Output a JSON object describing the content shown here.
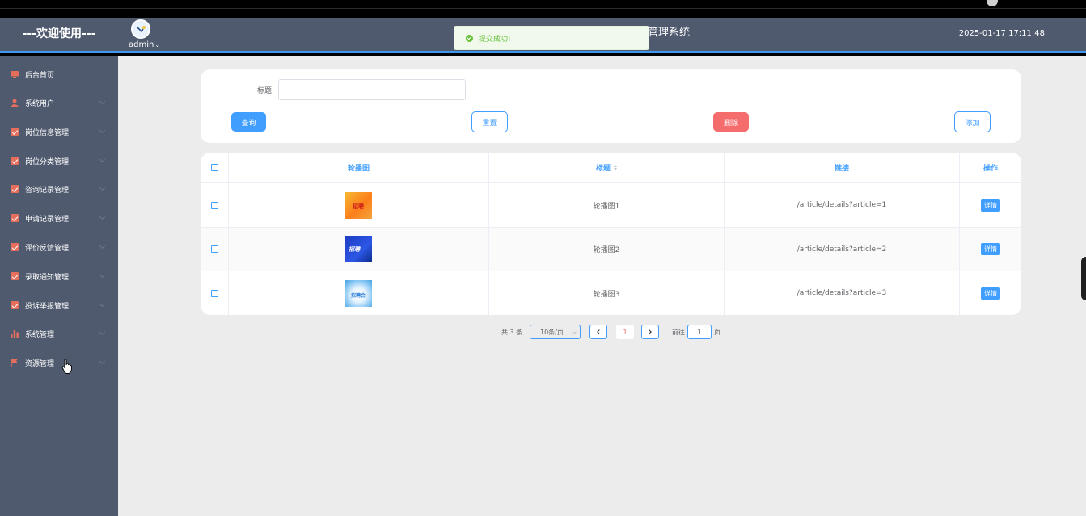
{
  "header": {
    "brand": "---欢迎使用---",
    "username": "admin",
    "title_partial": "管理系统",
    "datetime": "2025-01-17 17:11:48"
  },
  "toast": {
    "message": "提交成功!",
    "type": "success"
  },
  "sidebar": {
    "items": [
      {
        "label": "后台首页",
        "icon": "monitor-icon",
        "has_submenu": false
      },
      {
        "label": "系统用户",
        "icon": "user-icon",
        "has_submenu": true
      },
      {
        "label": "岗位信息管理",
        "icon": "checkbox-icon",
        "has_submenu": true
      },
      {
        "label": "岗位分类管理",
        "icon": "checkbox-icon",
        "has_submenu": true
      },
      {
        "label": "咨询记录管理",
        "icon": "checkbox-icon",
        "has_submenu": true
      },
      {
        "label": "申请记录管理",
        "icon": "checkbox-icon",
        "has_submenu": true
      },
      {
        "label": "评价反馈管理",
        "icon": "checkbox-icon",
        "has_submenu": true
      },
      {
        "label": "录取通知管理",
        "icon": "checkbox-icon",
        "has_submenu": true
      },
      {
        "label": "投诉举报管理",
        "icon": "checkbox-icon",
        "has_submenu": true
      },
      {
        "label": "系统管理",
        "icon": "bar-chart-icon",
        "has_submenu": true
      },
      {
        "label": "资源管理",
        "icon": "flag-icon",
        "has_submenu": true
      }
    ]
  },
  "search": {
    "title_label": "标题",
    "title_value": "",
    "query_label": "查询",
    "reset_label": "重置",
    "delete_label": "删除",
    "add_label": "添加"
  },
  "table": {
    "columns": [
      "轮播图",
      "标题",
      "链接",
      "操作"
    ],
    "rows": [
      {
        "image_text": "招聘",
        "title": "轮播图1",
        "link": "/article/details?article=1",
        "action": "详情"
      },
      {
        "image_text": "招聘",
        "title": "轮播图2",
        "link": "/article/details?article=2",
        "action": "详情"
      },
      {
        "image_text": "招聘会",
        "title": "轮播图3",
        "link": "/article/details?article=3",
        "action": "详情"
      }
    ]
  },
  "pagination": {
    "total": "共 3 条",
    "page_size": "10条/页",
    "current_page": "1",
    "goto_label": "前往",
    "goto_value": "1",
    "page_suffix": "页"
  },
  "colors": {
    "header_bg": "#4f5a6e",
    "accent": "#409eff",
    "danger": "#f56c6c",
    "success": "#67c23a",
    "menu_icon": "#e56e5c"
  }
}
